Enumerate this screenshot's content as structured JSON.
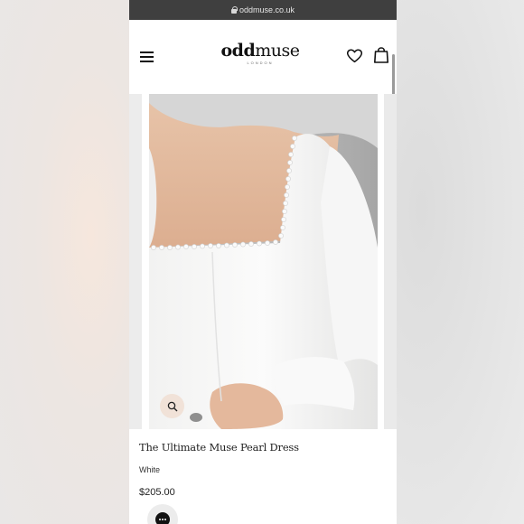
{
  "browser": {
    "url": "oddmuse.co.uk",
    "lock_icon": "lock-icon"
  },
  "header": {
    "menu_icon": "hamburger-menu-icon",
    "logo_text_bold": "odd",
    "logo_text_regular": "muse",
    "logo_subtext": "LONDON",
    "wishlist_icon": "heart-icon",
    "bag_icon": "shopping-bag-icon"
  },
  "gallery": {
    "image_alt": "The Ultimate Muse Pearl Dress",
    "zoom_icon": "magnifier-icon"
  },
  "product": {
    "title": "The Ultimate Muse Pearl Dress",
    "color": "White",
    "price": "$205.00"
  },
  "chat": {
    "icon": "chat-bubble-icon"
  },
  "colors": {
    "url_bar_bg": "#3f3f3f",
    "page_bg": "#ffffff",
    "text": "#222222"
  }
}
